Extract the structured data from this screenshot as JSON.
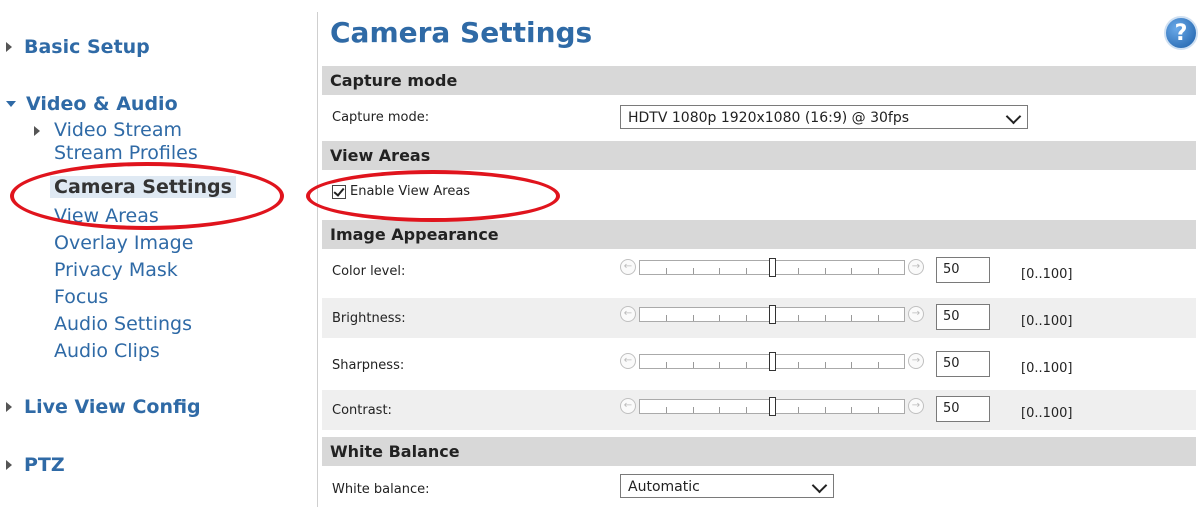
{
  "sidebar": {
    "sections": {
      "basic_setup": "Basic Setup",
      "video_audio": "Video & Audio",
      "live_view_config": "Live View Config",
      "ptz": "PTZ"
    },
    "video_audio_items": [
      "Video Stream",
      "Stream Profiles",
      "Camera Settings",
      "View Areas",
      "Overlay Image",
      "Privacy Mask",
      "Focus",
      "Audio Settings",
      "Audio Clips"
    ],
    "active_item": "Camera Settings"
  },
  "main": {
    "title": "Camera Settings",
    "help_icon_label": "?",
    "capture": {
      "header": "Capture mode",
      "label": "Capture mode:",
      "value": "HDTV 1080p 1920x1080 (16:9) @ 30fps"
    },
    "view_areas": {
      "header": "View Areas",
      "checkbox_label": "Enable View Areas",
      "checked": true
    },
    "image_appearance": {
      "header": "Image Appearance",
      "range": "[0..100]",
      "rows": [
        {
          "label": "Color level:",
          "value": "50"
        },
        {
          "label": "Brightness:",
          "value": "50"
        },
        {
          "label": "Sharpness:",
          "value": "50"
        },
        {
          "label": "Contrast:",
          "value": "50"
        }
      ]
    },
    "white_balance": {
      "header": "White Balance",
      "label": "White balance:",
      "value": "Automatic"
    }
  },
  "colors": {
    "link_blue": "#2f6aa6",
    "highlight_red": "#e0141d",
    "section_gray": "#d8d8d8"
  }
}
